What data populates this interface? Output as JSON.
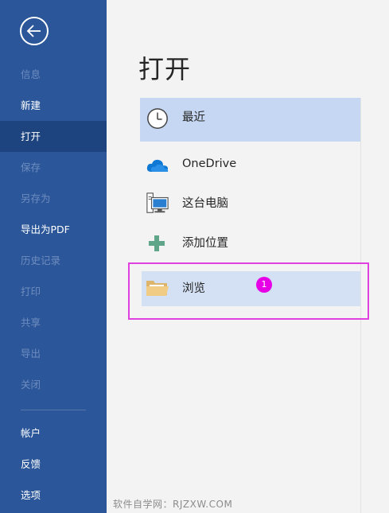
{
  "sidebar": {
    "back_icon": "back-arrow-icon",
    "items": [
      {
        "label": "信息",
        "state": "disabled"
      },
      {
        "label": "新建",
        "state": "enabled"
      },
      {
        "label": "打开",
        "state": "active"
      },
      {
        "label": "保存",
        "state": "disabled"
      },
      {
        "label": "另存为",
        "state": "disabled"
      },
      {
        "label": "导出为PDF",
        "state": "enabled"
      },
      {
        "label": "历史记录",
        "state": "disabled"
      },
      {
        "label": "打印",
        "state": "disabled"
      },
      {
        "label": "共享",
        "state": "disabled"
      },
      {
        "label": "导出",
        "state": "disabled"
      },
      {
        "label": "关闭",
        "state": "disabled"
      }
    ],
    "bottom_items": [
      {
        "label": "帐户"
      },
      {
        "label": "反馈"
      },
      {
        "label": "选项"
      }
    ]
  },
  "main": {
    "title": "打开",
    "locations": [
      {
        "label": "最近",
        "icon": "clock-icon",
        "state": "selected"
      },
      {
        "label": "OneDrive",
        "icon": "cloud-icon",
        "state": "normal"
      },
      {
        "label": "这台电脑",
        "icon": "computer-icon",
        "state": "normal"
      },
      {
        "label": "添加位置",
        "icon": "plus-icon",
        "state": "normal"
      },
      {
        "label": "浏览",
        "icon": "folder-icon",
        "state": "hover"
      }
    ],
    "step_badge": "1"
  },
  "watermark": "软件自学网：RJZXW.COM",
  "colors": {
    "sidebar_bg": "#2b579a",
    "sidebar_active": "#1e4480",
    "selected_bg": "#c5d7f2",
    "highlight_border": "#e040e0",
    "badge": "#e600e6"
  }
}
